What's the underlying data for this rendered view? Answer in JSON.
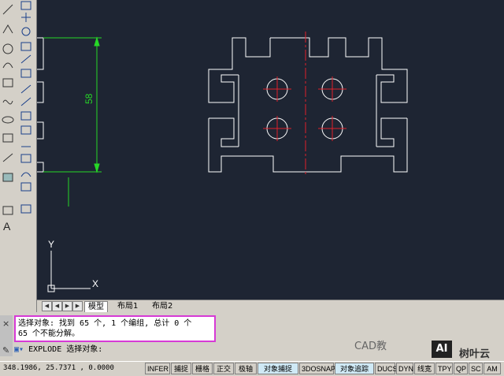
{
  "drawing": {
    "dimension_value": "58",
    "ucs_y_label": "Y",
    "ucs_x_label": "X"
  },
  "tabs": {
    "model": "模型",
    "layout1": "布局1",
    "layout2": "布局2"
  },
  "command": {
    "history_line1": "选择对象: 找到 65 个, 1 个编组, 总计 0 个",
    "history_line2": "65 个不能分解。",
    "current": "EXPLODE 选择对象:"
  },
  "status": {
    "coordinates": "348.1986, 25.7371 , 0.0000",
    "buttons": [
      "INFER",
      "捕捉",
      "栅格",
      "正交",
      "极轴",
      "对象捕捉",
      "3DOSNAP",
      "对象追踪",
      "DUCS",
      "DYN",
      "线宽",
      "TPY",
      "QP",
      "SC",
      "AM"
    ]
  },
  "watermark": {
    "text": "CAD教",
    "badge": "AI",
    "text2": "树叶云"
  },
  "colors": {
    "canvas": "#1e2533",
    "geometry": "#ffffff",
    "centerline": "#e0202a",
    "dimension": "#27d827",
    "highlight_box": "#d63ad6"
  }
}
